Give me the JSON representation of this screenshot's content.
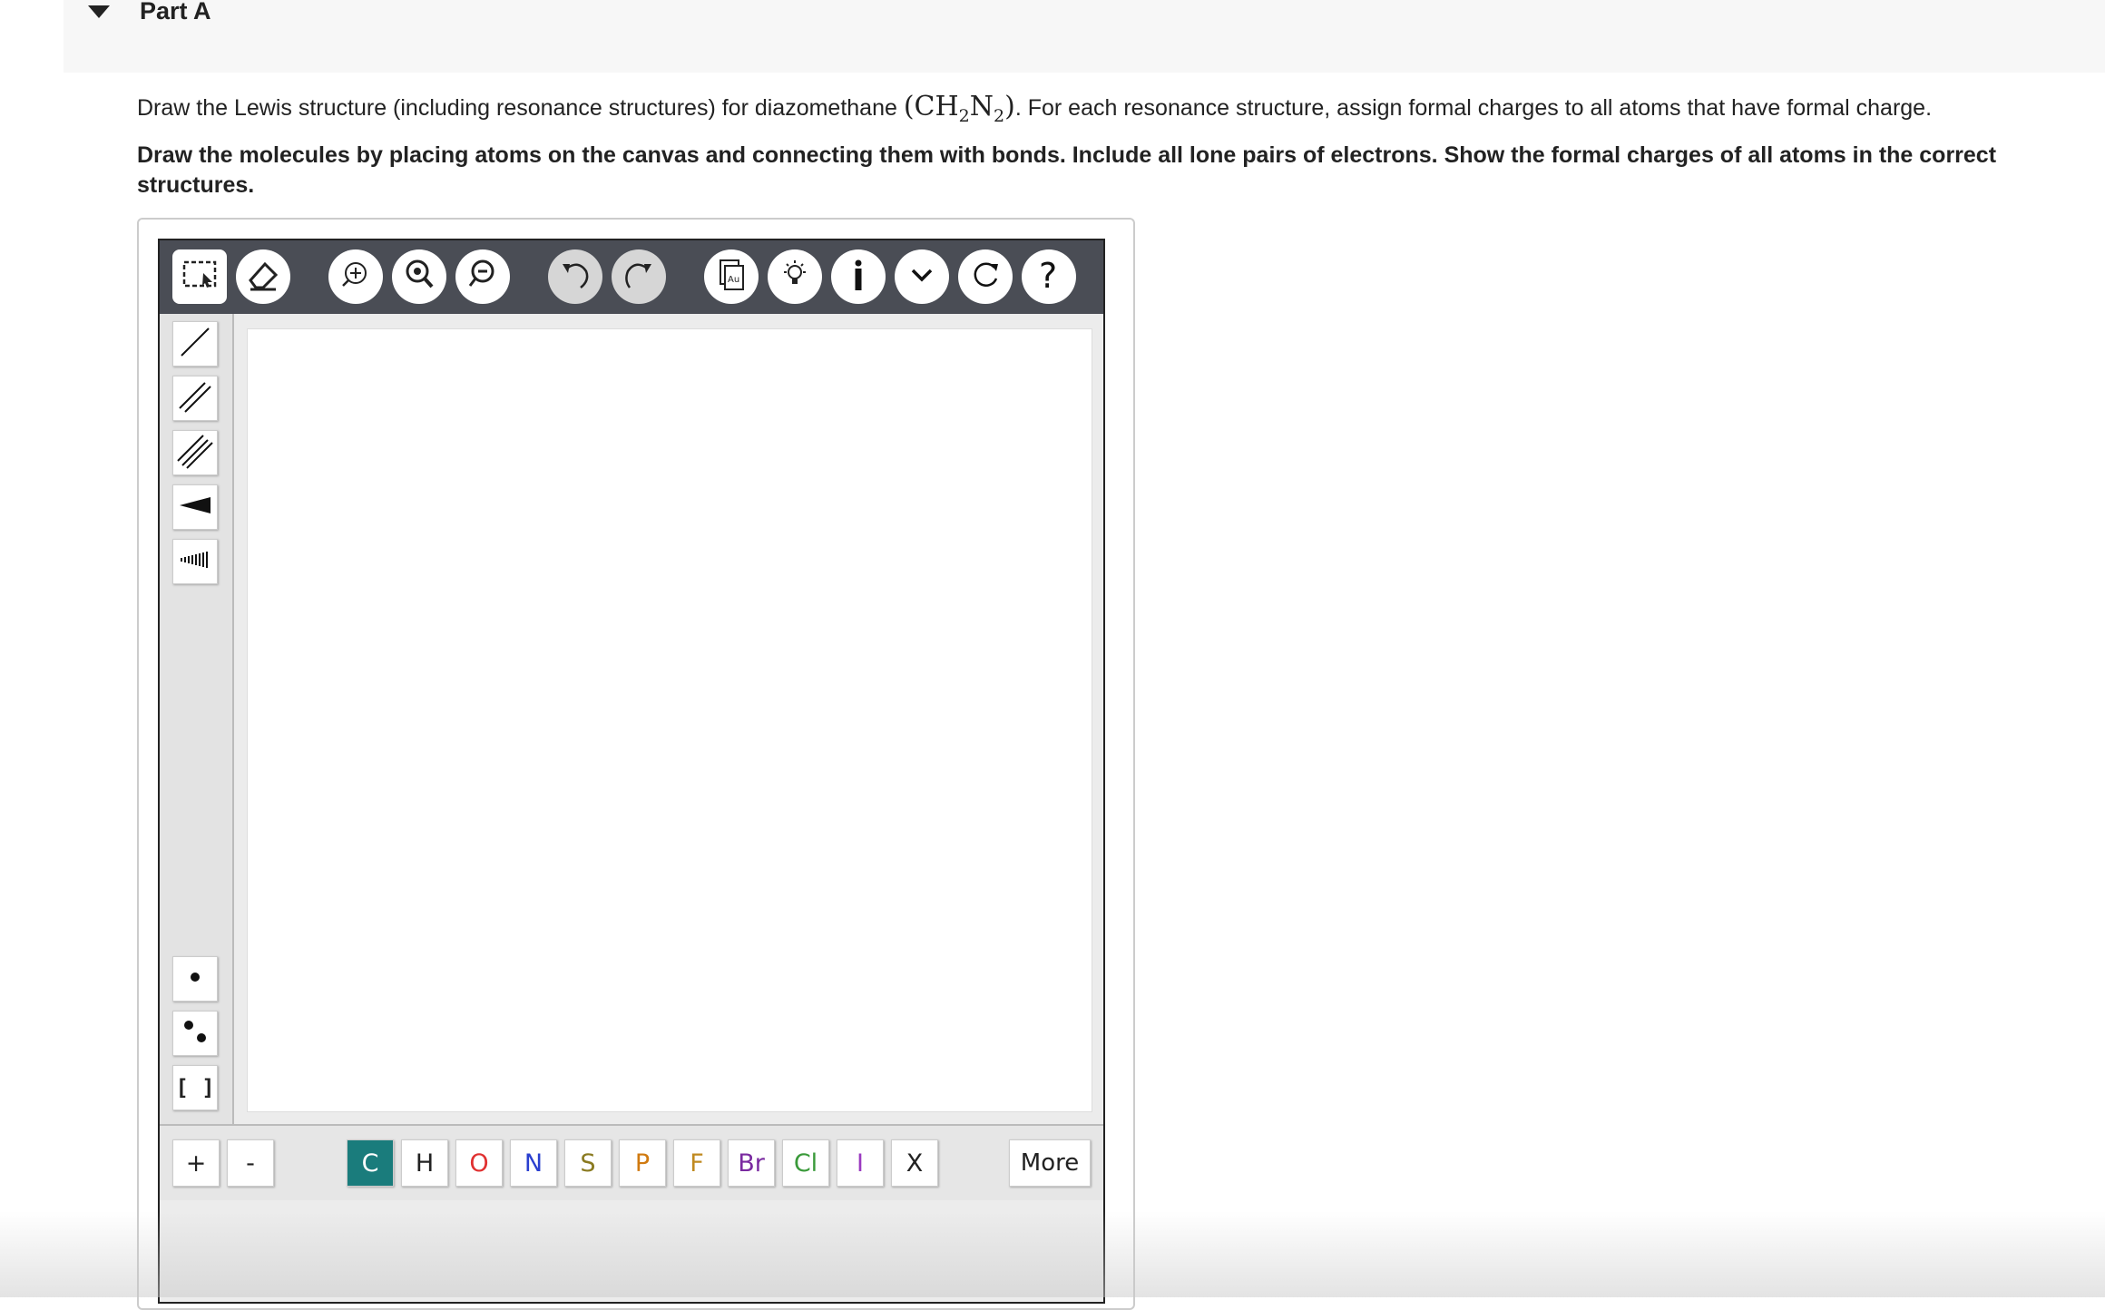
{
  "part": {
    "title": "Part A"
  },
  "question": {
    "line1_before": "Draw the Lewis structure (including resonance structures) for diazomethane ",
    "formula_open": "(CH",
    "formula_sub1": "2",
    "formula_mid": "N",
    "formula_sub2": "2",
    "formula_close": ")",
    "line1_after": ". For each resonance structure, assign formal charges to all atoms that have formal charge.",
    "instructions": "Draw the molecules by placing atoms on the canvas and connecting them with bonds. Include all lone pairs of electrons. Show the formal charges of all atoms in the correct structures."
  },
  "toolbar": {
    "icons": [
      "select-icon",
      "eraser-icon",
      "zoom-fit-icon",
      "zoom-in-icon",
      "zoom-out-icon",
      "undo-icon",
      "redo-icon",
      "templates-icon",
      "hint-icon",
      "info-icon",
      "expand-icon",
      "reset-icon",
      "help-icon"
    ],
    "templates_label": "Au",
    "help_label": "?"
  },
  "left_tools": {
    "icons": [
      "single-bond-icon",
      "double-bond-icon",
      "triple-bond-icon",
      "wedge-bond-icon",
      "hash-bond-icon",
      "radical-icon",
      "lone-pair-icon",
      "bracket-icon"
    ],
    "bracket_label": "[ ]"
  },
  "bottom": {
    "charges": [
      "+",
      "-"
    ],
    "elements": [
      {
        "symbol": "C",
        "color": "#ffffff",
        "selected": true
      },
      {
        "symbol": "H",
        "color": "#222222"
      },
      {
        "symbol": "O",
        "color": "#e03030"
      },
      {
        "symbol": "N",
        "color": "#2a3fcf"
      },
      {
        "symbol": "S",
        "color": "#8a7a20"
      },
      {
        "symbol": "P",
        "color": "#d07a10"
      },
      {
        "symbol": "F",
        "color": "#c08a20"
      },
      {
        "symbol": "Br",
        "color": "#7a2aa0"
      },
      {
        "symbol": "Cl",
        "color": "#3a9a3a"
      },
      {
        "symbol": "I",
        "color": "#9a3ac0"
      },
      {
        "symbol": "X",
        "color": "#222222"
      }
    ],
    "more_label": "More"
  },
  "colors": {
    "toolbar": "#4a4d55",
    "selected_element": "#1a7c7c"
  }
}
